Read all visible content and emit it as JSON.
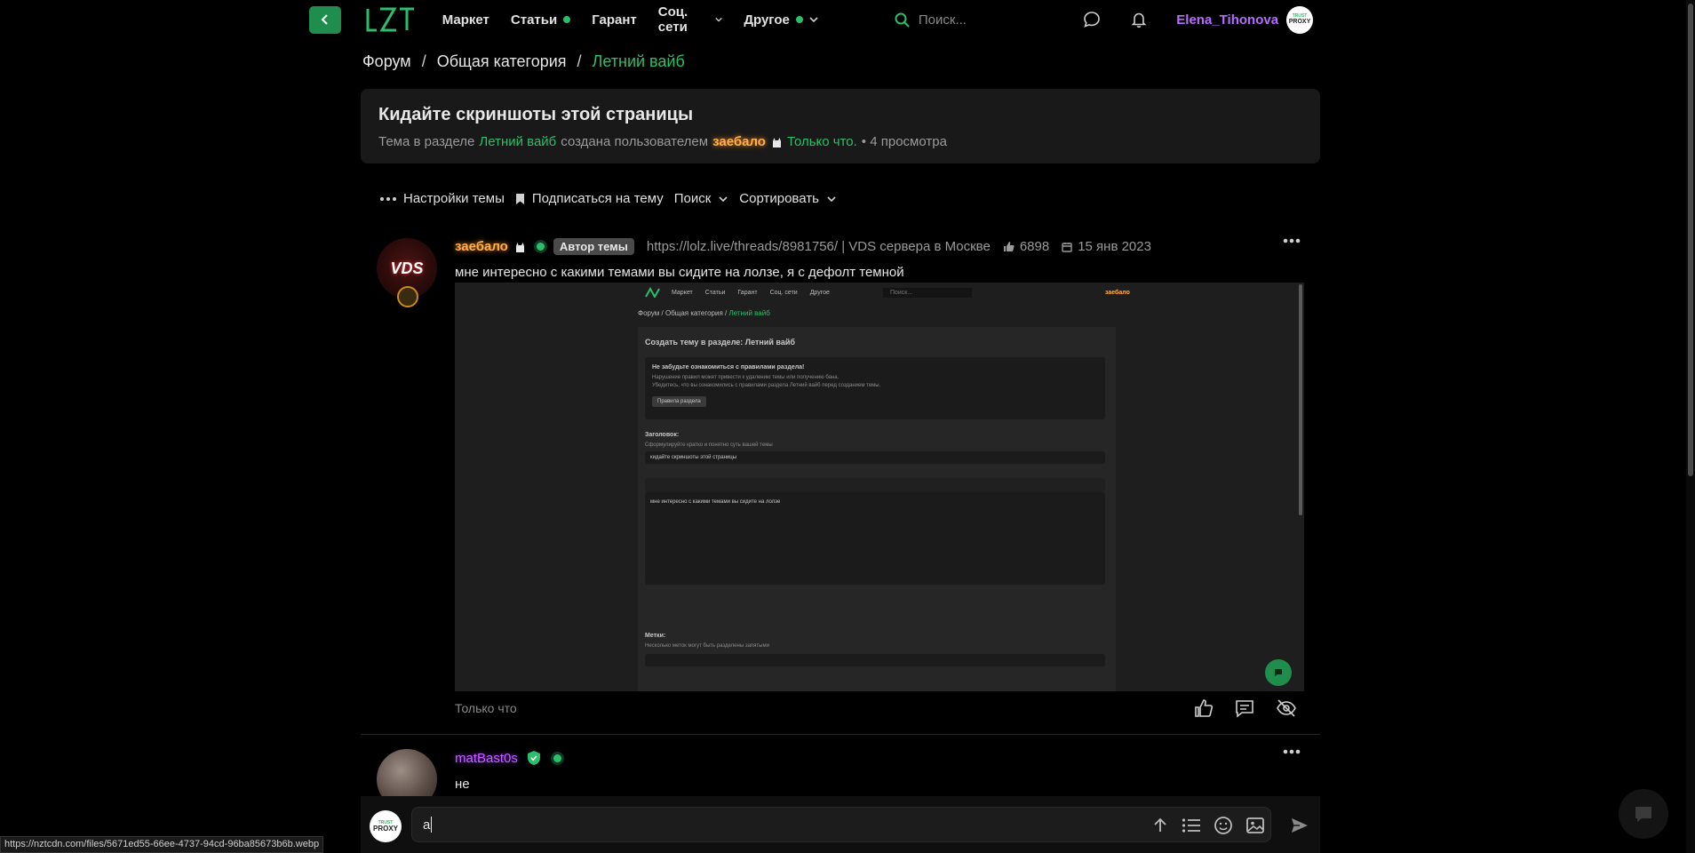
{
  "colors": {
    "accent": "#2dbe6c",
    "accent_dark": "#1f8d4c",
    "user_purple": "#b66dff",
    "author_orange": "#ffb04d"
  },
  "topnav": {
    "logo": "LZT",
    "items": [
      {
        "label": "Маркет",
        "dot": false,
        "chevron": false
      },
      {
        "label": "Статьи",
        "dot": true,
        "chevron": false
      },
      {
        "label": "Гарант",
        "dot": false,
        "chevron": false
      },
      {
        "label": "Соц. сети",
        "dot": false,
        "chevron": true
      },
      {
        "label": "Другое",
        "dot": true,
        "chevron": true
      }
    ],
    "search_placeholder": "Поиск...",
    "username": "Elena_Tihonova",
    "avatar_top": "TRUST",
    "avatar_bottom": "PROXY"
  },
  "breadcrumb": {
    "items": [
      "Форум",
      "Общая категория"
    ],
    "current": "Летний вайб",
    "separator": "/"
  },
  "thread": {
    "title": "Кидайте скриншоты этой страницы",
    "meta_prefix": "Тема в разделе",
    "meta_section": "Летний вайб",
    "meta_created_by": "создана пользователем",
    "meta_author": "заебало",
    "meta_time": "Только что.",
    "meta_views": "• 4 просмотра"
  },
  "toolbar": {
    "settings": "Настройки темы",
    "subscribe": "Подписаться на тему",
    "search": "Поиск",
    "sort": "Сортировать"
  },
  "post": {
    "author": "заебало",
    "author_tag": "Автор темы",
    "link": "https://lolz.live/threads/8981756/ | VDS сервера в Москве",
    "likes": "6898",
    "date": "15 янв 2023",
    "text": "мне интересно с какими темами вы сидите на лолзе, я с дефолт темной",
    "avatar_text": "VDS",
    "time": "Только что",
    "screenshot": {
      "nav": [
        "Маркет",
        "Статьи",
        "Гарант",
        "Соц. сети",
        "Другое"
      ],
      "search": "Поиск...",
      "crumbs": "Форум  /  Общая категория  /",
      "crumb_current": "Летний вайб",
      "panel_title": "Создать тему в разделе: Летний вайб",
      "notice_title": "Не забудьте ознакомиться с правилами раздела!",
      "notice_line1": "Нарушение правил может привести к удалению темы или получению бана.",
      "notice_line2": "Убедитесь, что вы ознакомились с правилами раздела Летний вайб перед созданием темы.",
      "notice_button": "Правила раздела",
      "title_label": "Заголовок:",
      "title_hint": "Сформулируйте кратко и понятно суть вашей темы",
      "title_value": "кидайте скриншоты этой страницы",
      "editor_text": "мне интересно с какими темами вы сидите на лолзе",
      "tags_label": "Метки:",
      "tags_hint": "Несколько меток могут быть разделены запятыми"
    }
  },
  "reply": {
    "author": "matBast0s",
    "text": "не"
  },
  "composer": {
    "value": "a",
    "avatar_top": "TRUST",
    "avatar_bottom": "PROXY"
  },
  "status_url": "https://nztcdn.com/files/5671ed55-66ee-4737-94cd-96ba85673b6b.webp"
}
